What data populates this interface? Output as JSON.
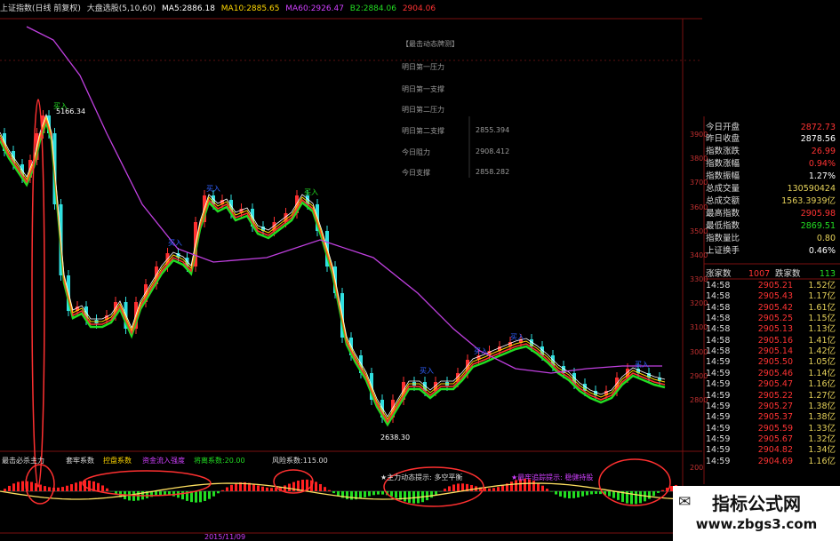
{
  "title_bar": {
    "name": "上证指数(日线 前复权)",
    "indicator": "大盘选股(5,10,60)",
    "ma5_label": "MA5:",
    "ma5_value": "2886.18",
    "ma10_label": "MA10:",
    "ma10_value": "2885.65",
    "ma60_label": "MA60:",
    "ma60_value": "2926.47",
    "b2_label": "B2:",
    "b2_value": "2884.06",
    "extra_value": "2904.06",
    "colors": {
      "ma5": "#ffffff",
      "ma10": "#ffd700",
      "ma60": "#d040ff",
      "b2": "#22dd22",
      "extra": "#ff3333"
    }
  },
  "predict_panel": {
    "header": "【最击动态牌测】",
    "rows": [
      {
        "label": "明日第一压力",
        "value": ""
      },
      {
        "label": "明日第一支撑",
        "value": ""
      },
      {
        "label": "明日第二压力",
        "value": ""
      },
      {
        "label": "明日第二支撑",
        "value": "2855.394"
      },
      {
        "label": "今日阻力",
        "value": "2908.412"
      },
      {
        "label": "今日支撑",
        "value": "2858.282"
      }
    ]
  },
  "price_axis": [
    "3900",
    "3800",
    "3700",
    "3600",
    "3500",
    "3400",
    "3300",
    "3200",
    "3100",
    "3000",
    "2900",
    "2800"
  ],
  "chart_annotations": {
    "high": "5166.34",
    "low": "2638.30",
    "buy_marker": "买入"
  },
  "quote_panel": {
    "rows": [
      {
        "label": "今日开盘",
        "value": "2872.73",
        "color": "#ff3333"
      },
      {
        "label": "昨日收盘",
        "value": "2878.56",
        "color": "#ffffff"
      },
      {
        "label": "指数涨跌",
        "value": "26.99",
        "color": "#ff3333"
      },
      {
        "label": "指数涨幅",
        "value": "0.94%",
        "color": "#ff3333"
      },
      {
        "label": "指数振幅",
        "value": "1.27%",
        "color": "#ffffff"
      },
      {
        "label": "总成交量",
        "value": "130590424",
        "color": "#e6d25a"
      },
      {
        "label": "总成交额",
        "value": "1563.3939亿",
        "color": "#e6d25a"
      },
      {
        "label": "最高指数",
        "value": "2905.98",
        "color": "#ff3333"
      },
      {
        "label": "最低指数",
        "value": "2869.51",
        "color": "#22dd22"
      },
      {
        "label": "指数量比",
        "value": "0.80",
        "color": "#e6d25a"
      },
      {
        "label": "上证换手",
        "value": "0.46%",
        "color": "#ffffff"
      }
    ],
    "breadth": {
      "up_label": "涨家数",
      "up_value": "1007",
      "down_label": "跌家数",
      "down_value": "113"
    }
  },
  "ticks": [
    {
      "time": "14:58",
      "price": "2905.21",
      "vol": "1.52亿"
    },
    {
      "time": "14:58",
      "price": "2905.43",
      "vol": "1.17亿"
    },
    {
      "time": "14:58",
      "price": "2905.42",
      "vol": "1.61亿"
    },
    {
      "time": "14:58",
      "price": "2905.25",
      "vol": "1.15亿"
    },
    {
      "time": "14:58",
      "price": "2905.13",
      "vol": "1.13亿"
    },
    {
      "time": "14:58",
      "price": "2905.16",
      "vol": "1.41亿"
    },
    {
      "time": "14:58",
      "price": "2905.14",
      "vol": "1.42亿"
    },
    {
      "time": "14:59",
      "price": "2905.50",
      "vol": "1.05亿"
    },
    {
      "time": "14:59",
      "price": "2905.46",
      "vol": "1.14亿"
    },
    {
      "time": "14:59",
      "price": "2905.47",
      "vol": "1.16亿"
    },
    {
      "time": "14:59",
      "price": "2905.22",
      "vol": "1.27亿"
    },
    {
      "time": "14:59",
      "price": "2905.27",
      "vol": "1.38亿"
    },
    {
      "time": "14:59",
      "price": "2905.37",
      "vol": "1.38亿"
    },
    {
      "time": "14:59",
      "price": "2905.59",
      "vol": "1.33亿"
    },
    {
      "time": "14:59",
      "price": "2905.67",
      "vol": "1.32亿"
    },
    {
      "time": "14:59",
      "price": "2904.82",
      "vol": "1.34亿"
    },
    {
      "time": "14:59",
      "price": "2904.69",
      "vol": "1.16亿"
    }
  ],
  "indicator_panel": {
    "name": "最击必杀主力",
    "l1": "套牢系数",
    "l2": "控盘系数",
    "l3": "资金流入强度",
    "l4": "将离系数:20.00",
    "risk": "风险系数:115.00",
    "note1": "★主力动态提示: 多空平衡",
    "note2": "★最牢追踪提示: 稳健持股",
    "axis": "200"
  },
  "date_axis": {
    "highlight": "2015/11/09"
  },
  "watermark": {
    "title": "指标公式网",
    "url": "www.zbgs3.com"
  }
}
